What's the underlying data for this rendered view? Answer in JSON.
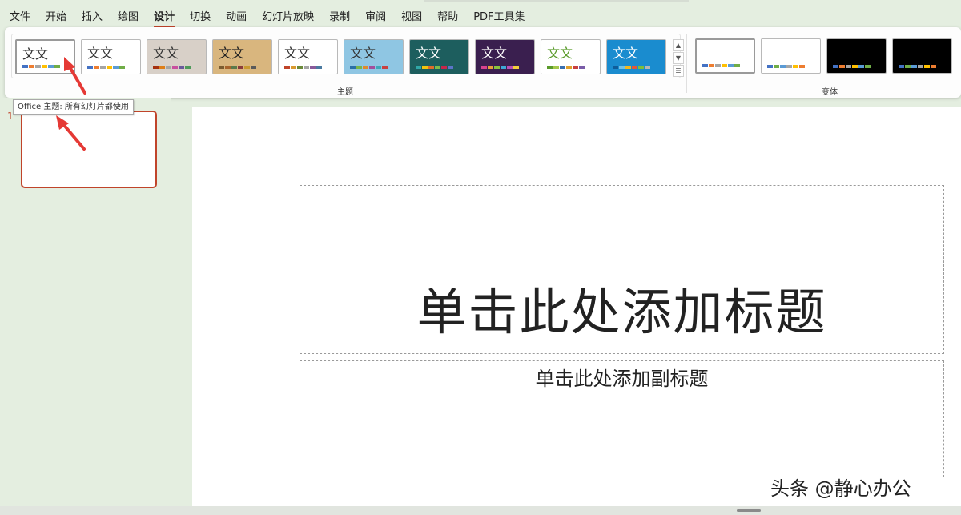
{
  "menu": {
    "items": [
      "文件",
      "开始",
      "插入",
      "绘图",
      "设计",
      "切换",
      "动画",
      "幻灯片放映",
      "录制",
      "审阅",
      "视图",
      "帮助",
      "PDF工具集"
    ],
    "active_index": 4
  },
  "ribbon": {
    "themes_label": "主题",
    "variants_label": "变体",
    "theme_thumb_text": [
      "文文",
      "文文",
      "文文",
      "文文",
      "文文",
      "文文",
      "文文",
      "文文",
      "文文",
      "文文"
    ],
    "themes": [
      {
        "bg": "#ffffff",
        "fg": "#333333",
        "swatches": [
          "#4472c4",
          "#ed7d31",
          "#a5a5a5",
          "#ffc000",
          "#5b9bd5",
          "#70ad47"
        ]
      },
      {
        "bg": "#ffffff",
        "fg": "#333333",
        "swatches": [
          "#4472c4",
          "#ed7d31",
          "#a5a5a5",
          "#ffc000",
          "#5b9bd5",
          "#70ad47"
        ]
      },
      {
        "bg": "#d8d0c8",
        "fg": "#333333",
        "swatches": [
          "#a53010",
          "#de7e18",
          "#a5a5a5",
          "#c94f9f",
          "#6b5a9b",
          "#4e9a5a"
        ]
      },
      {
        "bg": "#d9b67e",
        "fg": "#222222",
        "swatches": [
          "#7a5c30",
          "#a8642c",
          "#5b7a4c",
          "#8a3c3c",
          "#c99a30",
          "#5a5a5a"
        ]
      },
      {
        "bg": "#ffffff",
        "fg": "#333333",
        "swatches": [
          "#c0442a",
          "#d99a30",
          "#6a8a3a",
          "#a5a5a5",
          "#8a5a9a",
          "#4a7aa0"
        ]
      },
      {
        "bg": "#8fc6e3",
        "fg": "#333333",
        "swatches": [
          "#2a6fa8",
          "#7ab648",
          "#e08a2c",
          "#a34d9c",
          "#3ea8b8",
          "#c94040"
        ]
      },
      {
        "bg": "#1d5e5e",
        "fg": "#ffffff",
        "swatches": [
          "#30a7a7",
          "#f2c40d",
          "#e26b2b",
          "#7cbc4b",
          "#c8264a",
          "#5b74c9"
        ]
      },
      {
        "bg": "#3a1f4f",
        "fg": "#ffffff",
        "swatches": [
          "#d6428f",
          "#e7a03a",
          "#8ac43f",
          "#3ea8d6",
          "#ba4fb5",
          "#f2d03a"
        ]
      },
      {
        "bg": "#ffffff",
        "fg": "#5a9b2b",
        "swatches": [
          "#5a9b2b",
          "#a5c84c",
          "#3a6fb0",
          "#e0a02c",
          "#c94040",
          "#7a5ca8"
        ]
      },
      {
        "bg": "#1a8ccf",
        "fg": "#ffffff",
        "swatches": [
          "#0f5d9a",
          "#6fc2e8",
          "#f2b81e",
          "#e4553a",
          "#7bbf3a",
          "#b5b5b5"
        ]
      }
    ],
    "variants": [
      {
        "bg": "#ffffff",
        "swatches": [
          "#4472c4",
          "#ed7d31",
          "#a5a5a5",
          "#ffc000",
          "#5b9bd5",
          "#70ad47"
        ]
      },
      {
        "bg": "#ffffff",
        "swatches": [
          "#4472c4",
          "#70ad47",
          "#5b9bd5",
          "#a5a5a5",
          "#ffc000",
          "#ed7d31"
        ]
      },
      {
        "bg": "#000000",
        "swatches": [
          "#4472c4",
          "#ed7d31",
          "#a5a5a5",
          "#ffc000",
          "#5b9bd5",
          "#70ad47"
        ]
      },
      {
        "bg": "#000000",
        "swatches": [
          "#4472c4",
          "#70ad47",
          "#5b9bd5",
          "#a5a5a5",
          "#ffc000",
          "#ed7d31"
        ]
      }
    ]
  },
  "tooltip": "Office 主题: 所有幻灯片都使用",
  "slide_pane": {
    "slide_number": "1"
  },
  "slide": {
    "title": "单击此处添加标题",
    "subtitle": "单击此处添加副标题"
  },
  "watermark": "头条 @静心办公",
  "colors": {
    "accent": "#c0442a",
    "arrow": "#e53935"
  }
}
